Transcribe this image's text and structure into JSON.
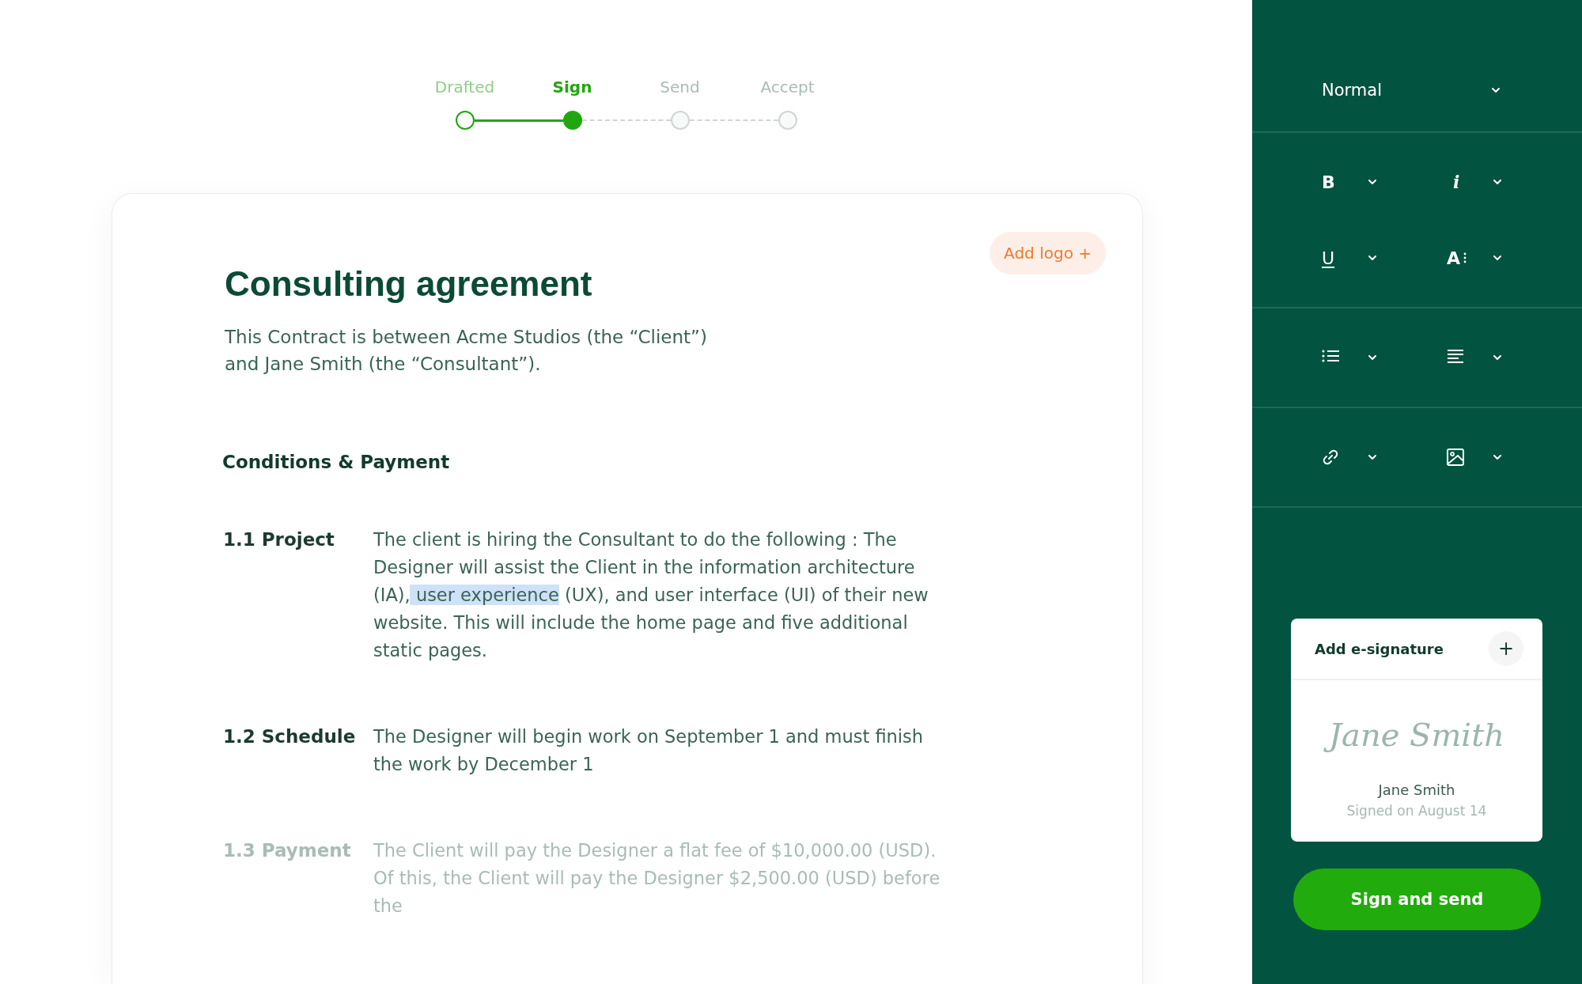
{
  "stepper": [
    {
      "label": "Drafted",
      "completed": true,
      "selected": false
    },
    {
      "label": "Sign",
      "completed": false,
      "selected": true
    },
    {
      "label": "Send",
      "completed": false,
      "selected": false
    },
    {
      "label": "Accept",
      "completed": false,
      "selected": false
    }
  ],
  "document": {
    "add_logo": "Add logo +",
    "title": "Consulting agreement",
    "intro": "This Contract is between Acme Studios (the “Client”) and Jane Smith (the “Consultant”).",
    "section_heading": "Conditions & Payment",
    "clauses": [
      {
        "label": "1.1 Project",
        "dimmed": false,
        "segments": [
          {
            "text": "The client is hiring the Consultant to do the following : The Designer will assist the Client in the information architecture (IA), ",
            "highlighted": false
          },
          {
            "text": "user experience",
            "highlighted": true
          },
          {
            "text": " (UX), and user interface (UI) of their new website. This will include the home page and five additional static pages.",
            "highlighted": false
          }
        ]
      },
      {
        "label": "1.2 Schedule",
        "dimmed": false,
        "segments": [
          {
            "text": "The Designer will begin work on September 1 and must finish the work by December 1",
            "highlighted": false
          }
        ]
      },
      {
        "label": "1.3 Payment",
        "dimmed": true,
        "segments": [
          {
            "text": "The Client will pay the Designer a flat fee of $10,000.00 (USD). Of this, the Client will pay the Designer $2,500.00 (USD) before the",
            "highlighted": false
          }
        ]
      }
    ]
  },
  "toolbar": {
    "style_select": "Normal",
    "groups": [
      [
        {
          "kind": "bold",
          "glyph": "B"
        },
        {
          "kind": "italic",
          "glyph": "i"
        },
        {
          "kind": "underline",
          "glyph": "U"
        },
        {
          "kind": "text-style",
          "glyph": "A"
        }
      ],
      [
        {
          "kind": "list"
        },
        {
          "kind": "align"
        }
      ],
      [
        {
          "kind": "link"
        },
        {
          "kind": "image"
        }
      ]
    ]
  },
  "signature_panel": {
    "title": "Add e-signature",
    "add_button": "+",
    "signature": "Jane Smith",
    "signer": "Jane Smith",
    "signed_on": "Signed on August 14"
  },
  "primary_button": "Sign and send"
}
